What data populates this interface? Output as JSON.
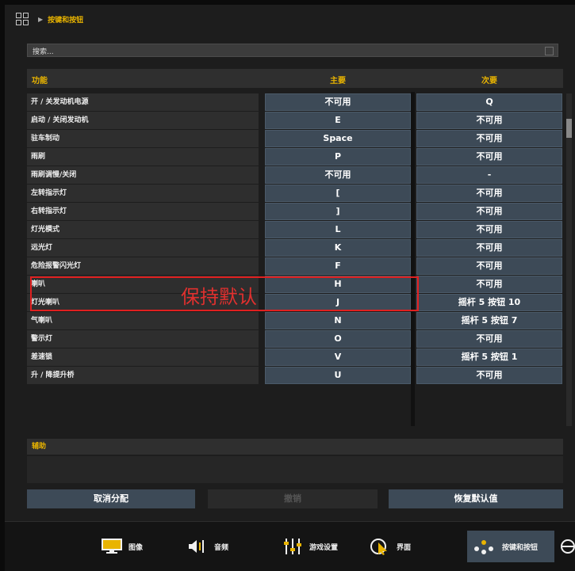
{
  "breadcrumb": {
    "current": "按键和按钮"
  },
  "search": {
    "value": "搜索..."
  },
  "table": {
    "headers": {
      "function": "功能",
      "primary": "主要",
      "secondary": "次要"
    },
    "rows": [
      {
        "function": "开 / 关发动机电源",
        "primary": "不可用",
        "secondary": "Q"
      },
      {
        "function": "启动 / 关闭发动机",
        "primary": "E",
        "secondary": "不可用"
      },
      {
        "function": "驻车制动",
        "primary": "Space",
        "secondary": "不可用"
      },
      {
        "function": "雨刷",
        "primary": "P",
        "secondary": "不可用"
      },
      {
        "function": "雨刷调慢/关闭",
        "primary": "不可用",
        "secondary": "-"
      },
      {
        "function": "左转指示灯",
        "primary": "[",
        "secondary": "不可用"
      },
      {
        "function": "右转指示灯",
        "primary": "]",
        "secondary": "不可用"
      },
      {
        "function": "灯光模式",
        "primary": "L",
        "secondary": "不可用"
      },
      {
        "function": "远光灯",
        "primary": "K",
        "secondary": "不可用"
      },
      {
        "function": "危险报警闪光灯",
        "primary": "F",
        "secondary": "不可用"
      },
      {
        "function": "喇叭",
        "primary": "H",
        "secondary": "不可用"
      },
      {
        "function": "灯光喇叭",
        "primary": "J",
        "secondary": "摇杆 5 按钮 10"
      },
      {
        "function": "气喇叭",
        "primary": "N",
        "secondary": "摇杆 5 按钮 7"
      },
      {
        "function": "警示灯",
        "primary": "O",
        "secondary": "不可用"
      },
      {
        "function": "差速锁",
        "primary": "V",
        "secondary": "摇杆 5 按钮 1"
      },
      {
        "function": "升 / 降提升桥",
        "primary": "U",
        "secondary": "不可用"
      }
    ]
  },
  "annotation": {
    "text": "保持默认",
    "color": "#e02020"
  },
  "aux": {
    "label": "辅助"
  },
  "buttons": {
    "unassign": "取消分配",
    "undo": "撤销",
    "restore": "恢复默认值"
  },
  "tabs": [
    {
      "label": "图像",
      "icon": "monitor-icon"
    },
    {
      "label": "音频",
      "icon": "speaker-icon"
    },
    {
      "label": "游戏设置",
      "icon": "sliders-icon"
    },
    {
      "label": "界面",
      "icon": "cursor-icon"
    },
    {
      "label": "按键和按钮",
      "icon": "gamepad-icon"
    }
  ],
  "colors": {
    "accent": "#e9b400",
    "cell": "#3d4a57"
  }
}
